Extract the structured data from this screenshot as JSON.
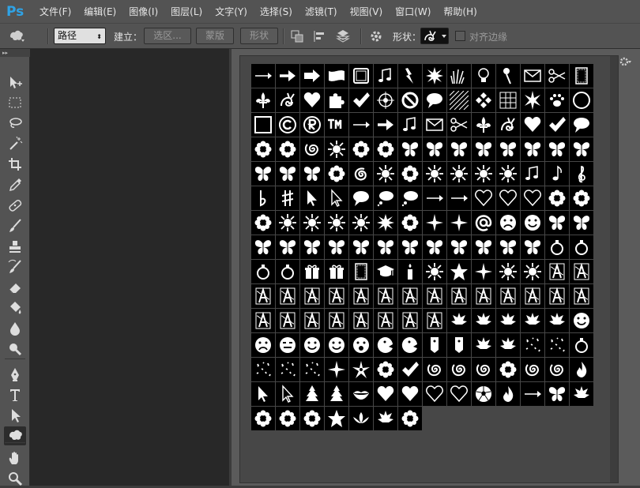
{
  "app": {
    "logo_text": "Ps"
  },
  "menu": [
    {
      "label": "文件(F)",
      "name": "menu-file"
    },
    {
      "label": "编辑(E)",
      "name": "menu-edit"
    },
    {
      "label": "图像(I)",
      "name": "menu-image"
    },
    {
      "label": "图层(L)",
      "name": "menu-layer"
    },
    {
      "label": "文字(Y)",
      "name": "menu-type"
    },
    {
      "label": "选择(S)",
      "name": "menu-select"
    },
    {
      "label": "滤镜(T)",
      "name": "menu-filter"
    },
    {
      "label": "视图(V)",
      "name": "menu-view"
    },
    {
      "label": "窗口(W)",
      "name": "menu-window"
    },
    {
      "label": "帮助(H)",
      "name": "menu-help"
    }
  ],
  "options": {
    "mode_value": "路径",
    "make_label": "建立：",
    "selection_label": "选区...",
    "mask_label": "蒙版",
    "shape_btn_label": "形状",
    "shape_label": "形状：",
    "align_label": "对齐边缘"
  },
  "colors": {
    "accent": "#2fa3e6",
    "panel": "#535353",
    "canvas": "#282828"
  },
  "tools": [
    {
      "name": "move-tool-icon",
      "icon": "move"
    },
    {
      "name": "marquee-tool-icon",
      "icon": "marquee"
    },
    {
      "name": "lasso-tool-icon",
      "icon": "lasso"
    },
    {
      "name": "magic-wand-tool-icon",
      "icon": "wand"
    },
    {
      "name": "crop-tool-icon",
      "icon": "crop"
    },
    {
      "name": "eyedropper-tool-icon",
      "icon": "eyedropper"
    },
    {
      "name": "healing-brush-tool-icon",
      "icon": "heal"
    },
    {
      "name": "brush-tool-icon",
      "icon": "brush"
    },
    {
      "name": "clone-stamp-tool-icon",
      "icon": "stamp"
    },
    {
      "name": "history-brush-tool-icon",
      "icon": "history"
    },
    {
      "name": "eraser-tool-icon",
      "icon": "eraser"
    },
    {
      "name": "paint-bucket-tool-icon",
      "icon": "bucket"
    },
    {
      "name": "blur-tool-icon",
      "icon": "blur"
    },
    {
      "name": "dodge-tool-icon",
      "icon": "dodge"
    },
    {
      "name": "pen-tool-icon",
      "icon": "pen"
    },
    {
      "name": "type-tool-icon",
      "icon": "type"
    },
    {
      "name": "path-selection-tool-icon",
      "icon": "path"
    },
    {
      "name": "custom-shape-tool-icon",
      "icon": "shape"
    },
    {
      "name": "hand-tool-icon",
      "icon": "hand"
    },
    {
      "name": "zoom-tool-icon",
      "icon": "zoom"
    }
  ],
  "shapes": [
    "arrow-thin",
    "arrow-bold",
    "arrow-block",
    "banner",
    "frame",
    "music-notes",
    "lightning",
    "starburst",
    "grass",
    "lightbulb",
    "pushpin",
    "envelope",
    "scissors",
    "frame-tall",
    "fleur-de-lis",
    "snail",
    "heart",
    "puzzle",
    "checkmark",
    "target",
    "no-sign",
    "speech-bubble",
    "hatch",
    "checker-diamond",
    "grid",
    "burst",
    "paw",
    "circle-outline",
    "square-outline",
    "copyright",
    "registered",
    "trademark",
    "arrow-thin",
    "arrow-bold",
    "music-notes",
    "envelope",
    "scissors",
    "fleur-de-lis",
    "snail",
    "heart",
    "checkmark",
    "speech-bubble",
    "flower",
    "flower",
    "swirl",
    "sun",
    "flower",
    "flower",
    "butterfly",
    "butterfly",
    "butterfly",
    "butterfly",
    "butterfly",
    "butterfly",
    "butterfly",
    "butterfly",
    "butterfly",
    "butterfly",
    "butterfly",
    "flower",
    "spiral",
    "sun",
    "flower",
    "sun",
    "sun",
    "sun",
    "sun",
    "music-notes",
    "music-note",
    "treble-clef",
    "flat",
    "sharp",
    "cursor",
    "cursor-outline",
    "speech-bubble",
    "thought-bubble",
    "thought-bubble",
    "arrow-thin",
    "arrow-thin",
    "heart-outline",
    "heart-outline",
    "heart-outline",
    "flower",
    "flower",
    "flower",
    "sun",
    "sun",
    "sun",
    "sun",
    "starburst",
    "flower",
    "star-4",
    "star-4",
    "at-sign",
    "sad-face",
    "smiley",
    "butterfly",
    "butterfly",
    "butterfly",
    "butterfly",
    "butterfly",
    "butterfly",
    "butterfly",
    "butterfly",
    "butterfly",
    "butterfly",
    "butterfly",
    "butterfly",
    "butterfly",
    "butterfly",
    "ornament",
    "ornament",
    "ornament",
    "ornament",
    "gift",
    "gift",
    "frame-tall",
    "graduation-cap",
    "candle",
    "sun",
    "star",
    "star-4",
    "sun",
    "sun",
    "letter",
    "letter",
    "letter",
    "letter",
    "letter",
    "letter",
    "letter",
    "letter",
    "letter",
    "letter",
    "letter",
    "letter",
    "letter",
    "letter",
    "letter",
    "letter",
    "letter",
    "letter",
    "letter",
    "letter",
    "letter",
    "letter",
    "letter",
    "letter",
    "leaf",
    "leaf",
    "leaf",
    "leaf",
    "leaf",
    "smiley",
    "sad-face",
    "neutral-face",
    "smiley",
    "smiley",
    "surprised-face",
    "face-side",
    "face-side",
    "tag",
    "tag",
    "leaf",
    "leaf",
    "sparkle",
    "sparkle",
    "ornament",
    "sparkle",
    "sparkle",
    "sparkle",
    "star-4",
    "starfish",
    "flower",
    "checkmark",
    "swirl",
    "swirl",
    "swirl",
    "flower",
    "swirl",
    "swirl",
    "flame",
    "cursor",
    "cursor-outline",
    "tree",
    "tree",
    "lips",
    "heart",
    "heart",
    "heart-outline",
    "heart-outline",
    "soccer-ball",
    "flame",
    "arrow-thin",
    "butterfly",
    "leaf",
    "flower",
    "flower",
    "flower",
    "star",
    "lotus",
    "leaf",
    "flower"
  ]
}
